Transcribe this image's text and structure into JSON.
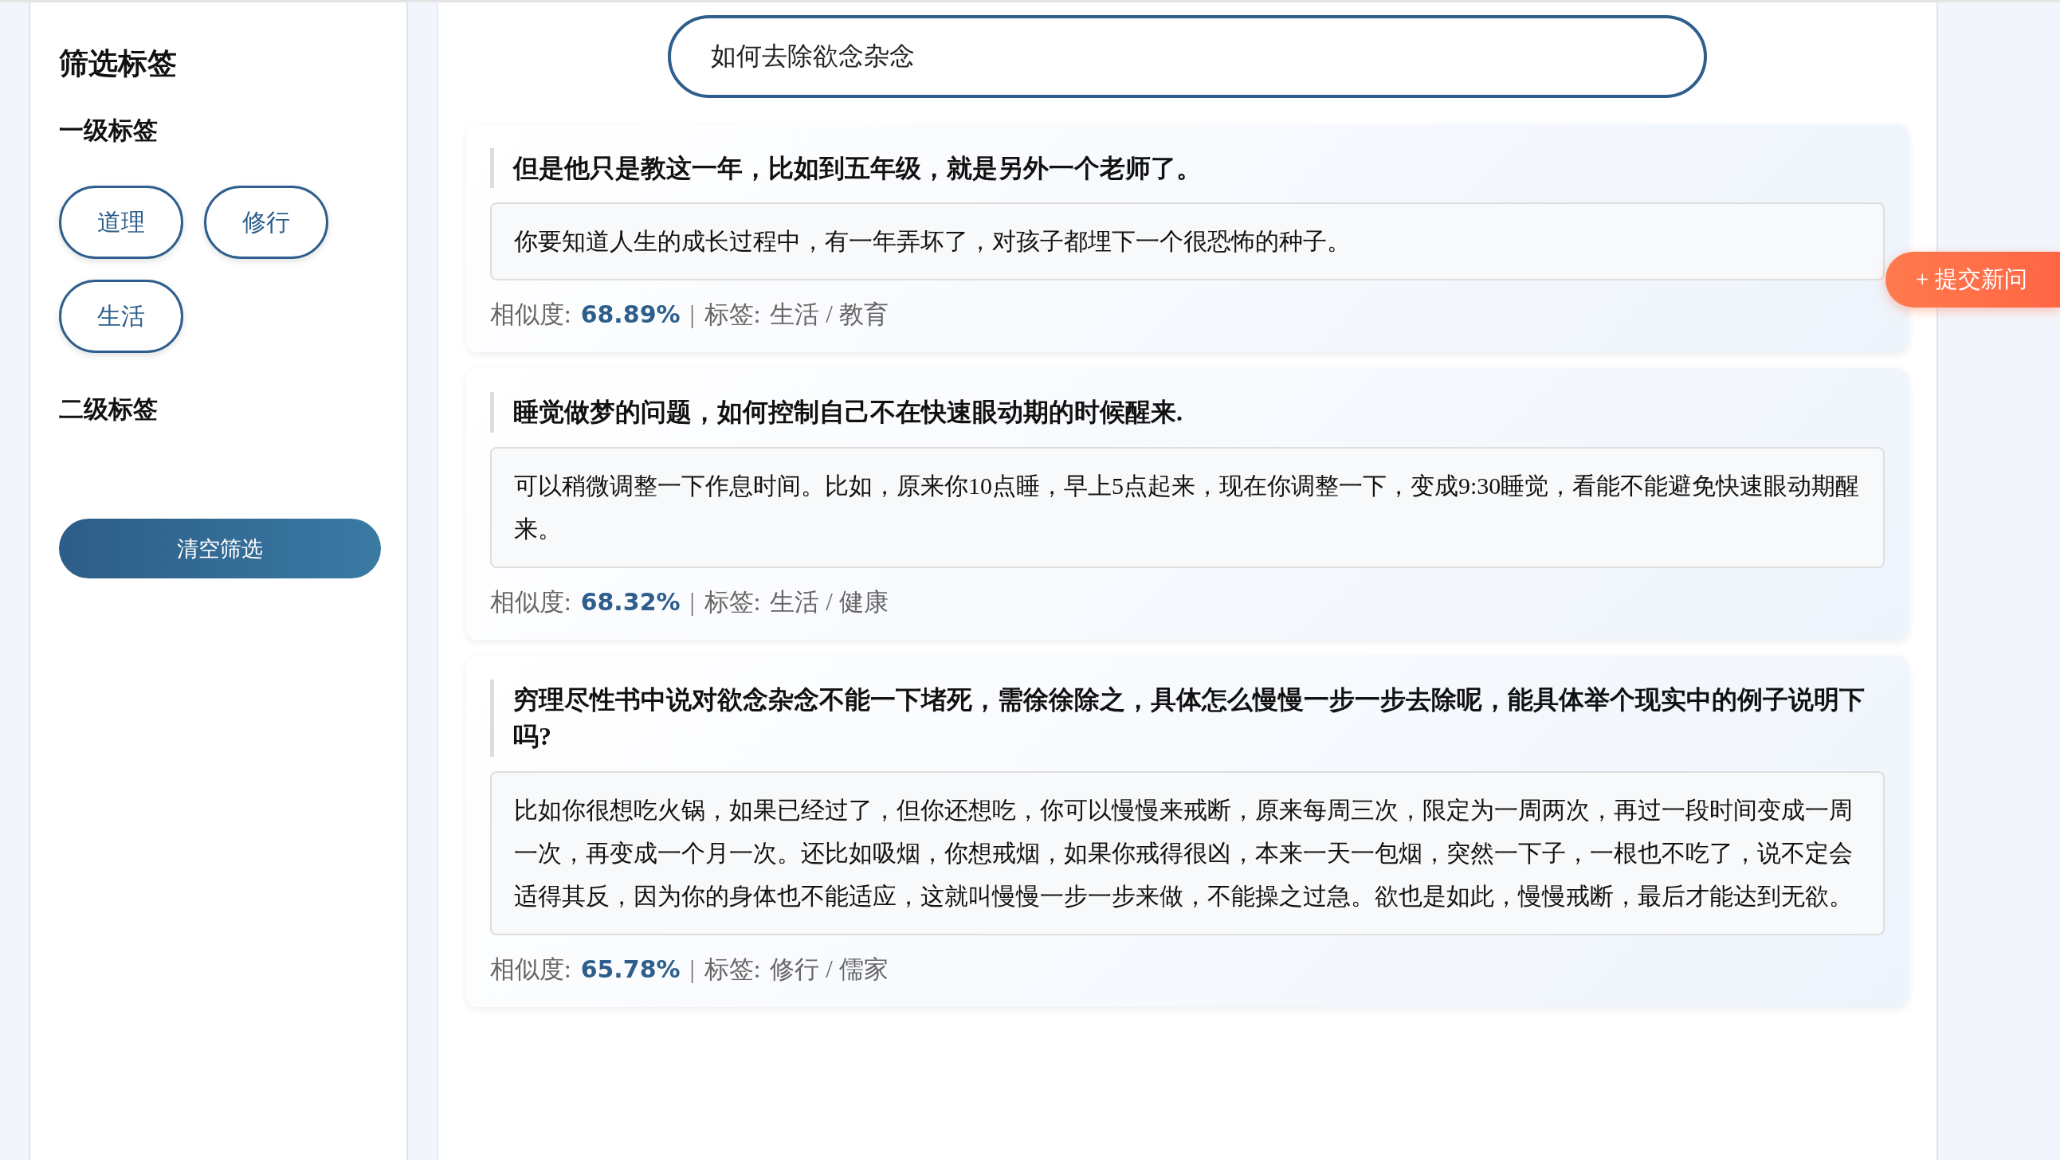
{
  "sidebar": {
    "title": "筛选标签",
    "level1": {
      "heading": "一级标签",
      "tags": [
        "道理",
        "修行",
        "生活"
      ]
    },
    "level2": {
      "heading": "二级标签"
    },
    "clear_button": "清空筛选"
  },
  "search": {
    "value": "如何去除欲念杂念"
  },
  "submit_button": "+ 提交新问",
  "results": [
    {
      "question": "但是他只是教这一年，比如到五年级，就是另外一个老师了。",
      "answer": "你要知道人生的成长过程中，有一年弄坏了，对孩子都埋下一个很恐怖的种子。",
      "similarity_label": "相似度:",
      "similarity": "68.89%",
      "separator": "|",
      "tags_label": "标签:",
      "tags": "生活 / 教育"
    },
    {
      "question": "睡觉做梦的问题，如何控制自己不在快速眼动期的时候醒来.",
      "answer": "可以稍微调整一下作息时间。比如，原来你10点睡，早上5点起来，现在你调整一下，变成9:30睡觉，看能不能避免快速眼动期醒来。",
      "similarity_label": "相似度:",
      "similarity": "68.32%",
      "separator": "|",
      "tags_label": "标签:",
      "tags": "生活 / 健康"
    },
    {
      "question": "穷理尽性书中说对欲念杂念不能一下堵死，需徐徐除之，具体怎么慢慢一步一步去除呢，能具体举个现实中的例子说明下吗?",
      "answer": "比如你很想吃火锅，如果已经过了，但你还想吃，你可以慢慢来戒断，原来每周三次，限定为一周两次，再过一段时间变成一周一次，再变成一个月一次。还比如吸烟，你想戒烟，如果你戒得很凶，本来一天一包烟，突然一下子，一根也不吃了，说不定会适得其反，因为你的身体也不能适应，这就叫慢慢一步一步来做，不能操之过急。欲也是如此，慢慢戒断，最后才能达到无欲。",
      "similarity_label": "相似度:",
      "similarity": "65.78%",
      "separator": "|",
      "tags_label": "标签:",
      "tags": "修行 / 儒家"
    }
  ]
}
